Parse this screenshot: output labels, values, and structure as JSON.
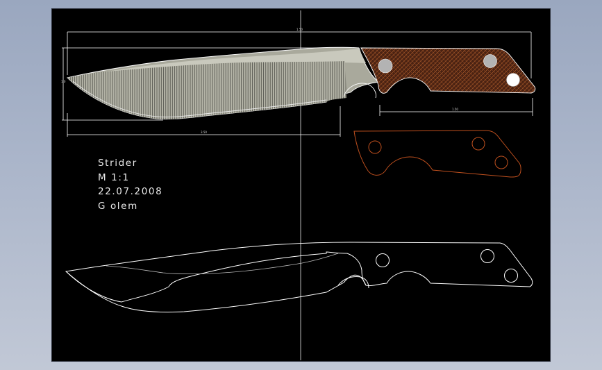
{
  "title_block": {
    "name": "Strider",
    "scale": "M  1:1",
    "date": "22.07.2008",
    "author": "G olem"
  },
  "dimensions": {
    "overall_length": "1.50",
    "blade_length": "3.50",
    "handle_length": "1.50",
    "blade_height": "1.0"
  },
  "colors": {
    "sheet_background": "#000000",
    "desktop_background": "#a9b4c9",
    "dimension_lines": "#ffffff",
    "blade_fill": "#b9b9ad",
    "handle_fill": "#5a2a14",
    "handle_outline": "#c0501e",
    "outline": "#ffffff"
  }
}
